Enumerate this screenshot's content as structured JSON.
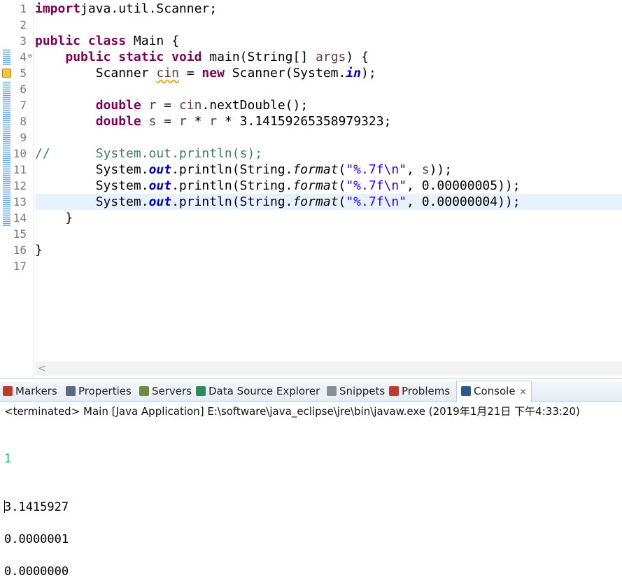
{
  "editor": {
    "line_numbers": [
      "1",
      "2",
      "3",
      "4",
      "5",
      "6",
      "7",
      "8",
      "9",
      "10",
      "11",
      "12",
      "13",
      "14",
      "15",
      "16",
      "17"
    ],
    "lines": [
      {
        "segs": [
          [
            "kw",
            "import"
          ],
          [
            "",
            "java.util.Scanner;"
          ]
        ]
      },
      {
        "segs": []
      },
      {
        "segs": [
          [
            "kw",
            "public"
          ],
          [
            "",
            " "
          ],
          [
            "kw",
            "class"
          ],
          [
            "",
            " Main {"
          ]
        ]
      },
      {
        "segs": [
          [
            "",
            "    "
          ],
          [
            "kw",
            "public"
          ],
          [
            "",
            " "
          ],
          [
            "kw",
            "static"
          ],
          [
            "",
            " "
          ],
          [
            "kw",
            "void"
          ],
          [
            "",
            " main(String[] "
          ],
          [
            "var",
            "args"
          ],
          [
            "",
            ") {"
          ]
        ]
      },
      {
        "segs": [
          [
            "",
            "        Scanner "
          ],
          [
            "var squig",
            "cin"
          ],
          [
            "",
            " = "
          ],
          [
            "kw",
            "new"
          ],
          [
            "",
            " Scanner(System."
          ],
          [
            "fld",
            "in"
          ],
          [
            "",
            ");"
          ]
        ]
      },
      {
        "segs": []
      },
      {
        "segs": [
          [
            "",
            "        "
          ],
          [
            "kw",
            "double"
          ],
          [
            "",
            " "
          ],
          [
            "var",
            "r"
          ],
          [
            "",
            " = "
          ],
          [
            "var",
            "cin"
          ],
          [
            "",
            ".nextDouble();"
          ]
        ]
      },
      {
        "segs": [
          [
            "",
            "        "
          ],
          [
            "kw",
            "double"
          ],
          [
            "",
            " "
          ],
          [
            "var",
            "s"
          ],
          [
            "",
            " = "
          ],
          [
            "var",
            "r"
          ],
          [
            "",
            " * "
          ],
          [
            "var",
            "r"
          ],
          [
            "",
            " * 3.14159265358979323;"
          ]
        ]
      },
      {
        "segs": []
      },
      {
        "segs": [
          [
            "cm",
            "//      System.out.println(s);"
          ]
        ]
      },
      {
        "segs": [
          [
            "",
            "        System."
          ],
          [
            "fld",
            "out"
          ],
          [
            "",
            ".println(String."
          ],
          [
            "ital",
            "format"
          ],
          [
            "",
            "("
          ],
          [
            "str",
            "\"%.7f\\n\""
          ],
          [
            "",
            ", "
          ],
          [
            "var",
            "s"
          ],
          [
            "",
            "));"
          ]
        ]
      },
      {
        "segs": [
          [
            "",
            "        System."
          ],
          [
            "fld",
            "out"
          ],
          [
            "",
            ".println(String."
          ],
          [
            "ital",
            "format"
          ],
          [
            "",
            "("
          ],
          [
            "str",
            "\"%.7f\\n\""
          ],
          [
            "",
            ", 0.00000005));"
          ]
        ]
      },
      {
        "segs": [
          [
            "",
            "        System."
          ],
          [
            "fld",
            "out"
          ],
          [
            "",
            ".println(String."
          ],
          [
            "ital",
            "format"
          ],
          [
            "",
            "("
          ],
          [
            "str",
            "\"%.7f\\n\""
          ],
          [
            "",
            ", 0.00000004));"
          ]
        ]
      },
      {
        "segs": [
          [
            "",
            "    }"
          ]
        ]
      },
      {
        "segs": []
      },
      {
        "segs": [
          [
            "",
            "}"
          ]
        ]
      },
      {
        "segs": []
      }
    ],
    "current_line": 13,
    "fold_marker": "⊖",
    "scroll_left_arrow": "<"
  },
  "tabs": [
    {
      "label": "Markers",
      "icon": "markers-icon"
    },
    {
      "label": "Properties",
      "icon": "properties-icon"
    },
    {
      "label": "Servers",
      "icon": "servers-icon"
    },
    {
      "label": "Data Source Explorer",
      "icon": "data-source-icon"
    },
    {
      "label": "Snippets",
      "icon": "snippets-icon"
    },
    {
      "label": "Problems",
      "icon": "problems-icon"
    },
    {
      "label": "Console",
      "icon": "console-icon",
      "active": true,
      "close": "✕"
    }
  ],
  "console": {
    "status": "<terminated> Main [Java Application] E:\\software\\java_eclipse\\jre\\bin\\javaw.exe (2019年1月21日 下午4:33:20)",
    "input_line": "1",
    "output": [
      "3.1415927",
      "",
      "0.0000001",
      "",
      "0.0000000"
    ]
  },
  "colors": {
    "keyword": "#7f0055",
    "string": "#2a00ff",
    "comment": "#3f7f5f",
    "field": "#0000c0",
    "console_input": "#00c87d",
    "current_line": "#e8f2fe"
  }
}
